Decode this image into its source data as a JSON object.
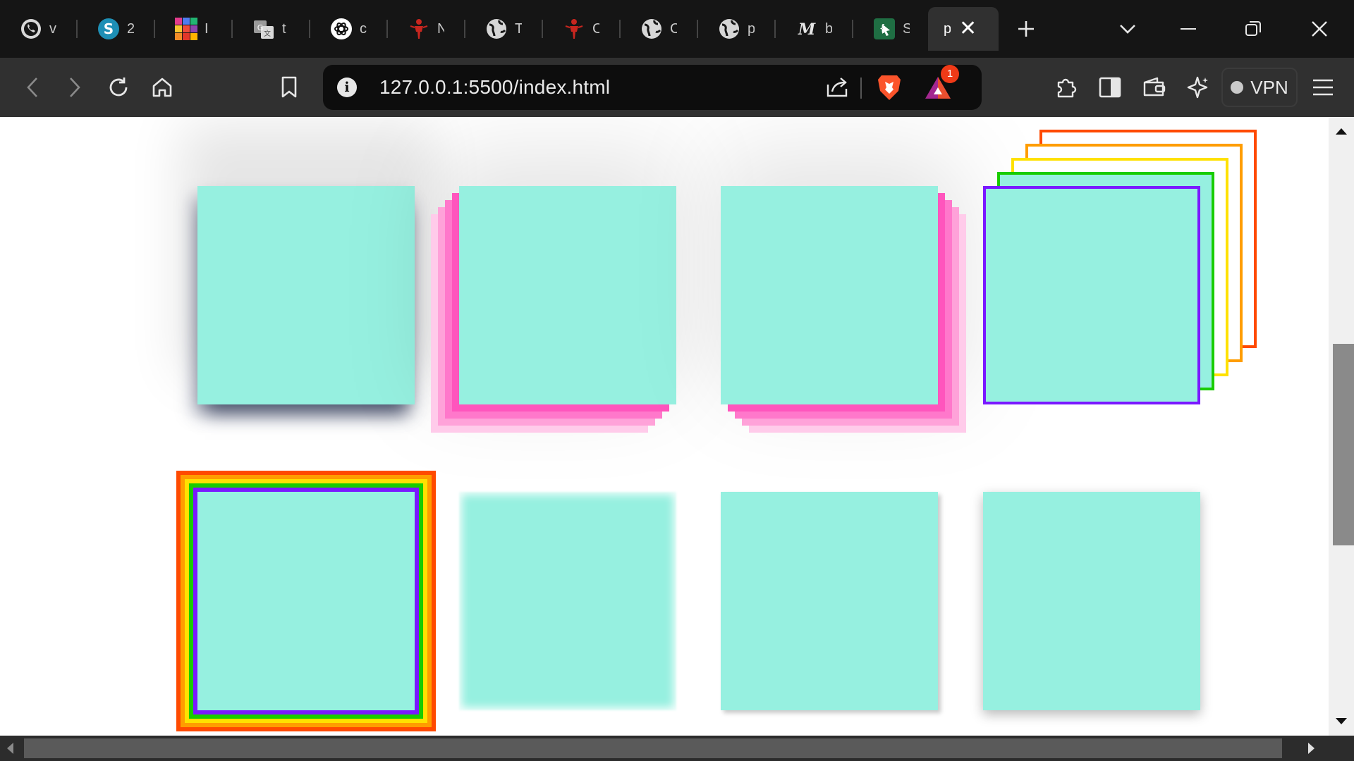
{
  "tabs": [
    {
      "title": "v",
      "icon": "whatsapp-icon"
    },
    {
      "title": "2",
      "icon": "skype-icon"
    },
    {
      "title": "I",
      "icon": "color-grid-icon"
    },
    {
      "title": "t",
      "icon": "google-translate-icon"
    },
    {
      "title": "c",
      "icon": "chatgpt-icon"
    },
    {
      "title": "N",
      "icon": "red-figure-icon"
    },
    {
      "title": "T",
      "icon": "globe-icon"
    },
    {
      "title": "C",
      "icon": "red-figure-icon"
    },
    {
      "title": "C",
      "icon": "globe-icon"
    },
    {
      "title": "p",
      "icon": "globe-icon"
    },
    {
      "title": "b",
      "icon": "medium-icon"
    },
    {
      "title": "S",
      "icon": "code-cursor-icon"
    },
    {
      "title": "p",
      "icon": "",
      "active": true
    }
  ],
  "address_bar": {
    "url": "127.0.0.1:5500/index.html"
  },
  "brave_badge_count": "1",
  "vpn_label": "VPN",
  "colors": {
    "box_fill": "#96f0e0",
    "pink_shadow": "#ff55bd",
    "rainbow": [
      "#7a19ff",
      "#19cc00",
      "#ffe100",
      "#ff9d00",
      "#ff4a00"
    ]
  }
}
